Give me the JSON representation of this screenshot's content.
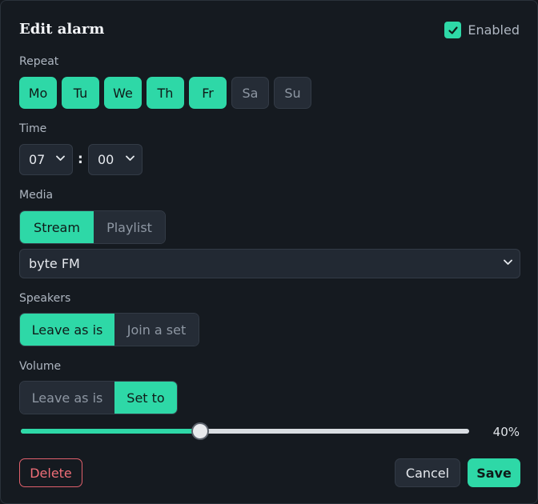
{
  "dialog": {
    "title": "Edit alarm",
    "enabled_label": "Enabled",
    "enabled": true
  },
  "repeat": {
    "label": "Repeat",
    "days": [
      {
        "label": "Mo",
        "selected": true
      },
      {
        "label": "Tu",
        "selected": true
      },
      {
        "label": "We",
        "selected": true
      },
      {
        "label": "Th",
        "selected": true
      },
      {
        "label": "Fr",
        "selected": true
      },
      {
        "label": "Sa",
        "selected": false
      },
      {
        "label": "Su",
        "selected": false
      }
    ]
  },
  "time": {
    "label": "Time",
    "hour": "07",
    "minute": "00",
    "separator": ":"
  },
  "media": {
    "label": "Media",
    "options": [
      {
        "label": "Stream",
        "selected": true
      },
      {
        "label": "Playlist",
        "selected": false
      }
    ],
    "station": "byte FM"
  },
  "speakers": {
    "label": "Speakers",
    "options": [
      {
        "label": "Leave as is",
        "selected": true
      },
      {
        "label": "Join a set",
        "selected": false
      }
    ]
  },
  "volume": {
    "label": "Volume",
    "options": [
      {
        "label": "Leave as is",
        "selected": false
      },
      {
        "label": "Set to",
        "selected": true
      }
    ],
    "level": 0.4,
    "display": "40%"
  },
  "actions": {
    "delete": "Delete",
    "cancel": "Cancel",
    "save": "Save"
  },
  "colors": {
    "accent": "#2ed8a7",
    "danger": "#f06e78",
    "background": "#151a20"
  }
}
